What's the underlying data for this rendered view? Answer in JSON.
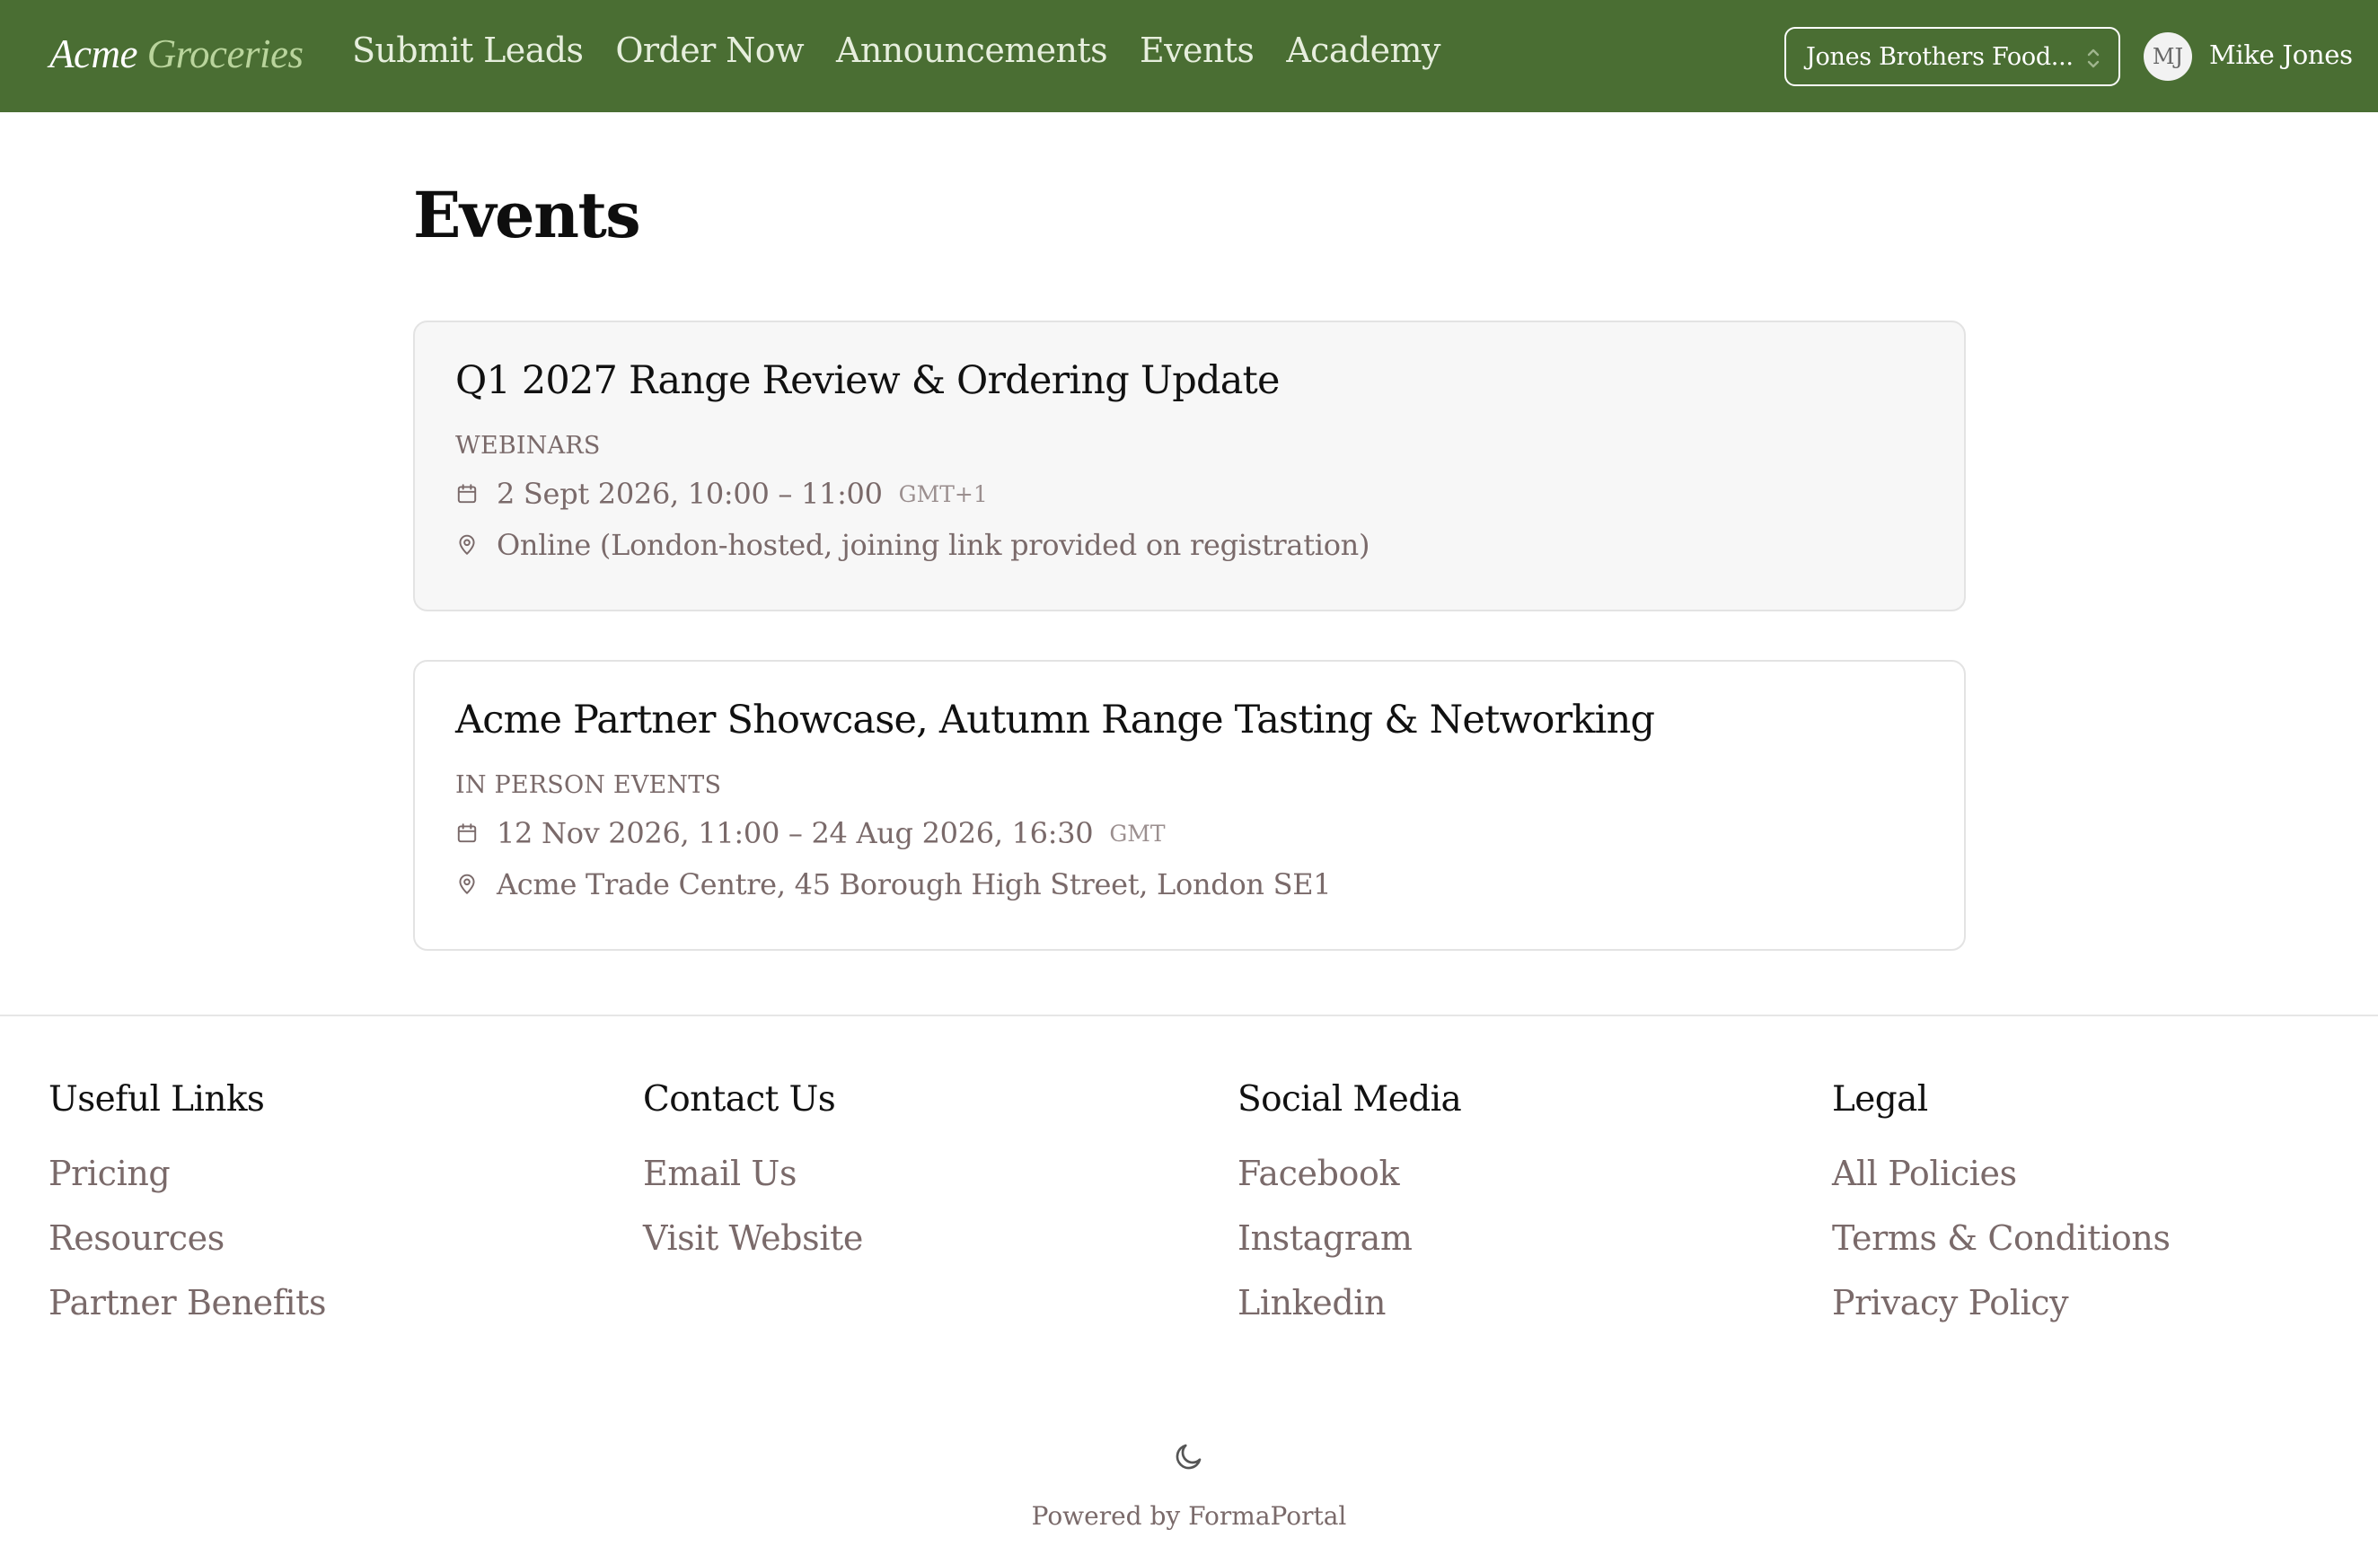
{
  "brand": {
    "part1": "Acme",
    "part2": " Groceries"
  },
  "nav": {
    "items": [
      {
        "label": "Submit Leads"
      },
      {
        "label": "Order Now"
      },
      {
        "label": "Announcements"
      },
      {
        "label": "Events"
      },
      {
        "label": "Academy"
      }
    ]
  },
  "org_selector": {
    "value": "Jones Brothers Food..."
  },
  "user": {
    "initials": "MJ",
    "name": "Mike Jones"
  },
  "page": {
    "title": "Events"
  },
  "events": [
    {
      "title": "Q1 2027 Range Review & Ordering Update",
      "category": "WEBINARS",
      "datetime": "2 Sept 2026, 10:00 – 11:00",
      "timezone": "GMT+1",
      "location": "Online (London-hosted, joining link provided on registration)"
    },
    {
      "title": "Acme Partner Showcase, Autumn Range Tasting & Networking",
      "category": "IN PERSON EVENTS",
      "datetime": "12 Nov 2026, 11:00 – 24 Aug 2026, 16:30",
      "timezone": "GMT",
      "location": "Acme Trade Centre, 45 Borough High Street, London SE1"
    }
  ],
  "footer": {
    "columns": [
      {
        "heading": "Useful Links",
        "links": [
          "Pricing",
          "Resources",
          "Partner Benefits"
        ]
      },
      {
        "heading": "Contact Us",
        "links": [
          "Email Us",
          "Visit Website"
        ]
      },
      {
        "heading": "Social Media",
        "links": [
          "Facebook",
          "Instagram",
          "Linkedin"
        ]
      },
      {
        "heading": "Legal",
        "links": [
          "All Policies",
          "Terms & Conditions",
          "Privacy Policy"
        ]
      }
    ],
    "powered_by": "Powered by FormaPortal"
  },
  "icons": {
    "calendar": "calendar-icon",
    "location": "map-pin-icon",
    "theme": "moon-icon",
    "select": "chevron-up-down-icon"
  },
  "colors": {
    "header_bg": "#4a6e33",
    "brand_accent": "#b9d49c",
    "muted_text": "#7a6a6a"
  }
}
